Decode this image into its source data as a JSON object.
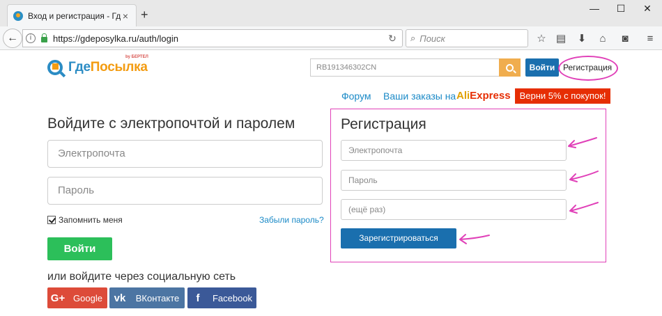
{
  "browser": {
    "tab_title": "Вход и регистрация - ГдеПо",
    "tab_close": "×",
    "new_tab": "+",
    "window_controls": [
      "—",
      "☐",
      "✕"
    ],
    "url": "https://gdeposylka.ru/auth/login",
    "search_placeholder": "Поиск",
    "reload_icon": "↻",
    "back_icon": "←",
    "info_icon": "i",
    "toolbar_icons": [
      "bookmark-star-icon",
      "reading-list-icon",
      "download-icon",
      "home-icon",
      "pocket-icon",
      "menu-icon"
    ]
  },
  "header": {
    "logo_part1": "Где",
    "logo_part2": "Посылка",
    "logo_sub": "by БЕРТЕЛ",
    "track_placeholder": "RB191346302CN",
    "login_button": "Войти",
    "register_button": "Регистрация"
  },
  "top_links": {
    "forum": "Форум",
    "orders": "Ваши заказы на",
    "ali_part1": "Ali",
    "ali_part2": "Express",
    "promo": "Верни 5% с покупок!"
  },
  "login": {
    "title": "Войдите с электропочтой и паролем",
    "email_placeholder": "Электропочта",
    "password_placeholder": "Пароль",
    "remember_label": "Запомнить меня",
    "forgot_link": "Забыли пароль?",
    "submit": "Войти",
    "social_label": "или войдите через социальную сеть",
    "social": [
      {
        "icon": "G+",
        "label": "Google"
      },
      {
        "icon": "vk",
        "label": "ВКонтакте"
      },
      {
        "icon": "f",
        "label": "Facebook"
      }
    ]
  },
  "registration": {
    "title": "Регистрация",
    "email_placeholder": "Электропочта",
    "password_placeholder": "Пароль",
    "repeat_placeholder": "(ещё раз)",
    "submit": "Зарегистрироваться"
  },
  "colors": {
    "annotation": "#e040b8",
    "primary": "#1a6fae",
    "success": "#2cbf5a",
    "link": "#1b8ac7",
    "google": "#dd4b39",
    "vk": "#4c75a3",
    "facebook": "#3b5998",
    "track_button": "#f0ad4e",
    "promo": "#e62e04"
  }
}
